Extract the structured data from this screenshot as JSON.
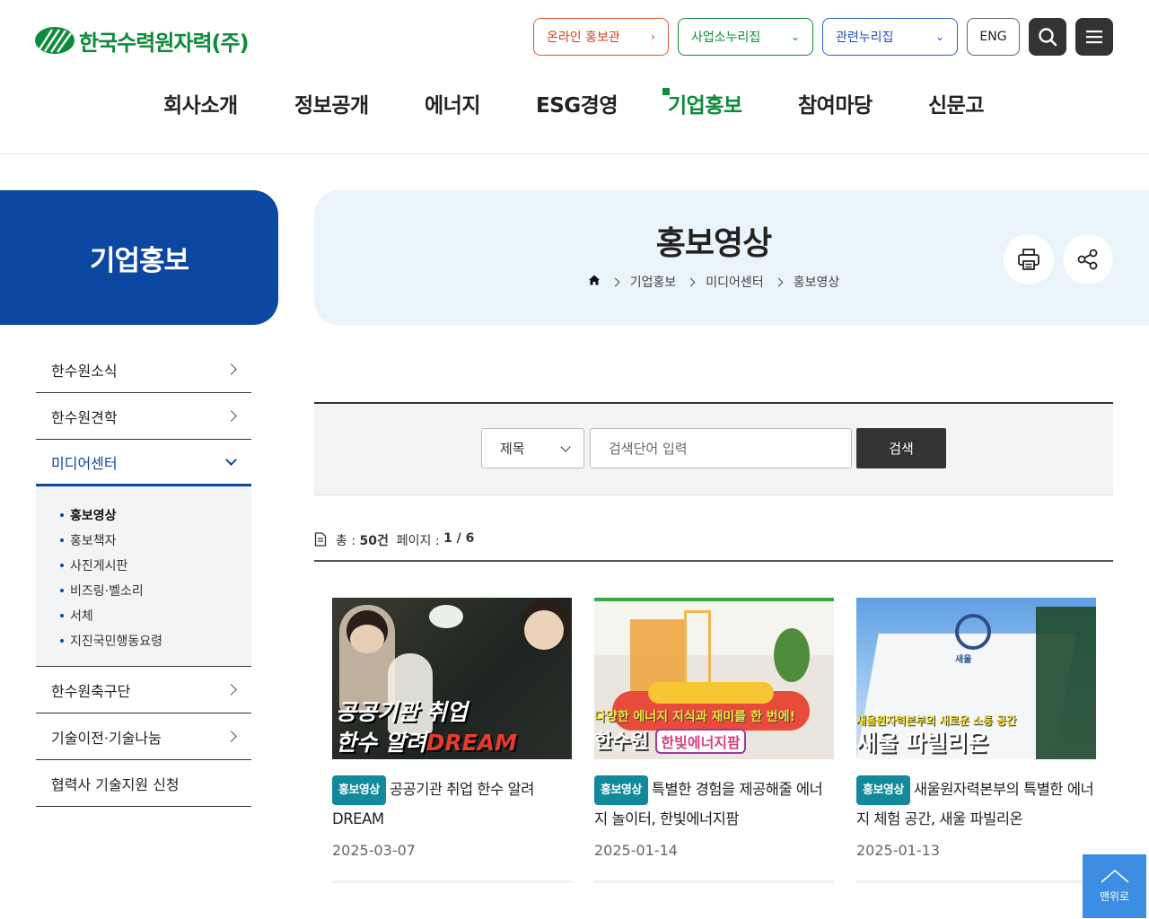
{
  "header": {
    "logo_text": "한국수력원자력(주)",
    "util": {
      "online_label": "온라인 홍보관",
      "biz_label": "사업소누리집",
      "related_label": "관련누리집",
      "eng_label": "ENG"
    },
    "gnb": [
      "회사소개",
      "정보공개",
      "에너지",
      "ESG경영",
      "기업홍보",
      "참여마당",
      "신문고"
    ],
    "gnb_active": "기업홍보"
  },
  "side": {
    "title": "기업홍보",
    "menu": [
      {
        "label": "한수원소식"
      },
      {
        "label": "한수원견학"
      },
      {
        "label": "미디어센터",
        "open": true
      },
      {
        "label": "한수원축구단"
      },
      {
        "label": "기술이전·기술나눔"
      },
      {
        "label": "협력사 기술지원 신청"
      }
    ],
    "submenu": [
      "홍보영상",
      "홍보책자",
      "사진게시판",
      "비즈링·벨소리",
      "서체",
      "지진국민행동요령"
    ],
    "submenu_current": "홍보영상"
  },
  "page": {
    "title": "홍보영상",
    "breadcrumb": [
      "기업홍보",
      "미디어센터",
      "홍보영상"
    ]
  },
  "search": {
    "select_value": "제목",
    "placeholder": "검색단어 입력",
    "button_label": "검색"
  },
  "count": {
    "total_label": "총 :",
    "total_value": "50건",
    "page_label": "페이지 :",
    "page_value": "1 / 6"
  },
  "cards": [
    {
      "badge": "홍보영상",
      "title": "공공기관 취업 한수 알려DREAM",
      "date": "2025-03-07",
      "thumb_line1": "공공기관 취업",
      "thumb_line2": "한수 알려",
      "thumb_accent": "DREAM"
    },
    {
      "badge": "홍보영상",
      "title": "특별한 경험을 제공해줄 에너지 놀이터, 한빛에너지팜",
      "date": "2025-01-14",
      "thumb_line1": "다양한 에너지 지식과 재미를 한 번에!",
      "thumb_line2": "한수원",
      "thumb_accent": "한빛에너지팜"
    },
    {
      "badge": "홍보영상",
      "title": "새울원자력본부의 특별한 에너지 체험 공간, 새울 파빌리온",
      "date": "2025-01-13",
      "thumb_line1": "새울원자력본부의 새로운 소통 공간",
      "thumb_line2": "새울 파빌리온",
      "thumb_accent": "새울"
    }
  ],
  "top_button_label": "맨위로",
  "colors": {
    "brand_green": "#0d8b3b",
    "brand_blue": "#0c47a1",
    "badge_teal": "#138a9c",
    "top_button": "#3b8ee4"
  }
}
